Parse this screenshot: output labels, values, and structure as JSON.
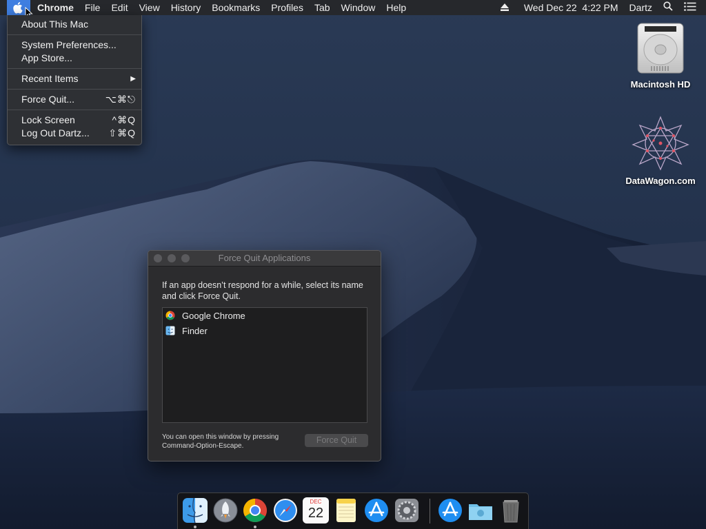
{
  "menubar": {
    "app_name": "Chrome",
    "items": [
      "File",
      "Edit",
      "View",
      "History",
      "Bookmarks",
      "Profiles",
      "Tab",
      "Window",
      "Help"
    ],
    "clock": "Wed Dec 22  4:22 PM",
    "user": "Dartz"
  },
  "apple_menu": {
    "about": "About This Mac",
    "system_prefs": "System Preferences...",
    "app_store": "App Store...",
    "recent_items": "Recent Items",
    "recent_arrow": "▶",
    "force_quit": "Force Quit...",
    "force_quit_shortcut": "⌥⌘⎋",
    "lock_screen": "Lock Screen",
    "lock_screen_shortcut": "^⌘Q",
    "log_out": "Log Out Dartz...",
    "log_out_shortcut": "⇧⌘Q"
  },
  "desktop": {
    "hd_label": "Macintosh HD",
    "datawagon_label": "DataWagon.com"
  },
  "force_quit_window": {
    "title": "Force Quit Applications",
    "description": "If an app doesn’t respond for a while, select its name and click Force Quit.",
    "apps": [
      "Google Chrome",
      "Finder"
    ],
    "hint": "You can open this window by pressing Command-Option-Escape.",
    "button": "Force Quit"
  },
  "dock": {
    "calendar_month": "DEC",
    "calendar_day": "22",
    "apps": [
      "finder-icon",
      "launchpad-icon",
      "chrome-icon",
      "safari-icon",
      "calendar-icon",
      "notes-icon",
      "app-store-icon",
      "system-preferences-icon",
      "app-store-icon",
      "downloads-folder-icon",
      "trash-icon"
    ]
  }
}
